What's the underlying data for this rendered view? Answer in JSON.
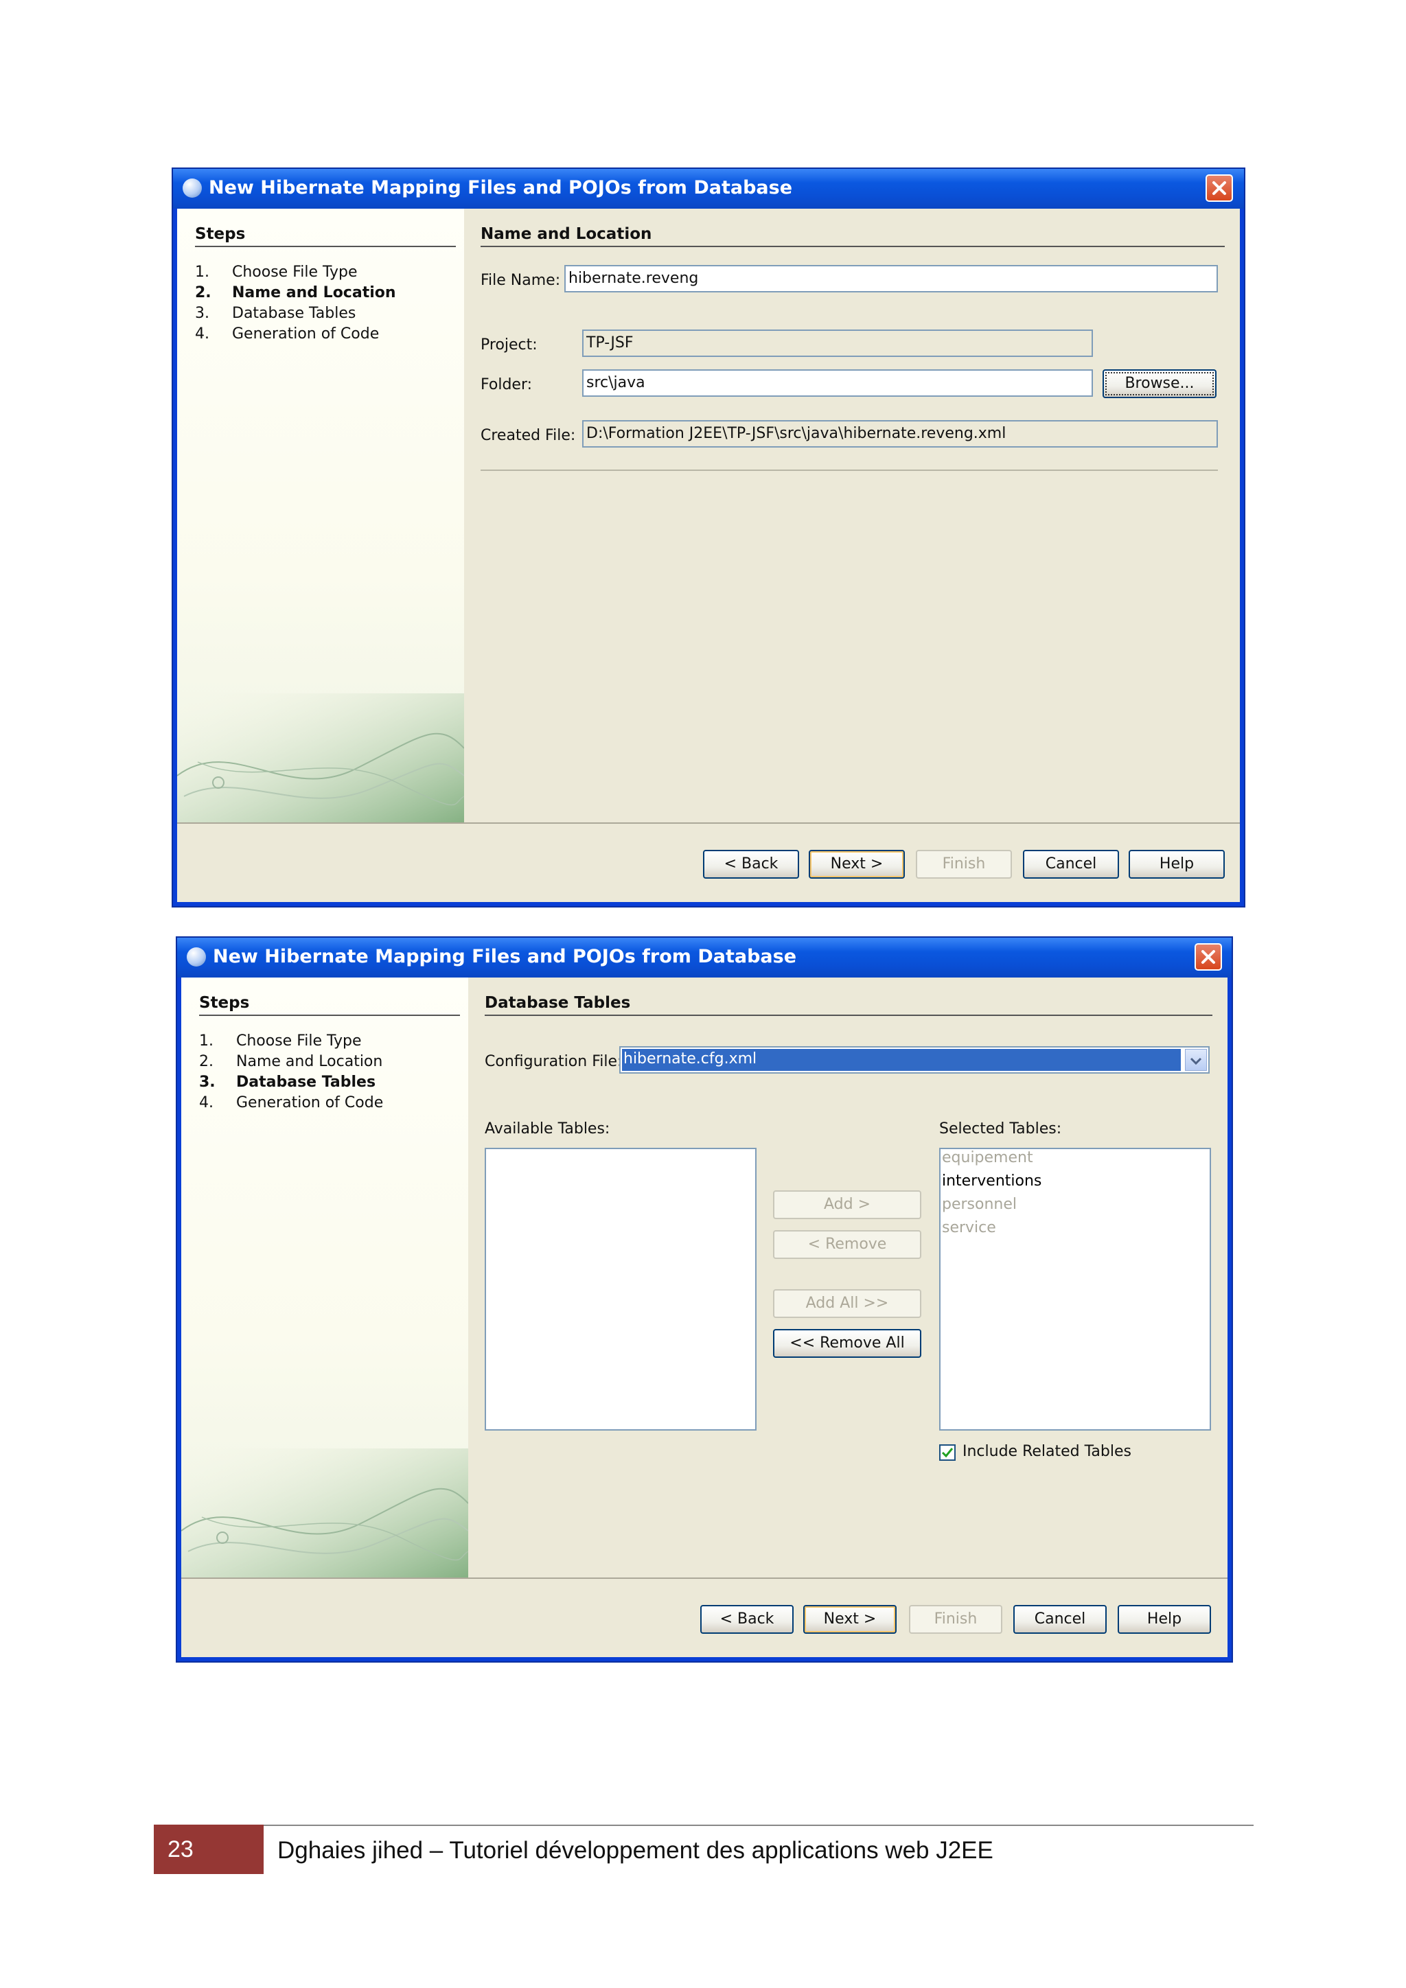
{
  "dialog1": {
    "title": "New Hibernate Mapping Files and POJOs from Database",
    "steps_heading": "Steps",
    "steps": [
      {
        "num": "1.",
        "label": "Choose File Type"
      },
      {
        "num": "2.",
        "label": "Name and Location"
      },
      {
        "num": "3.",
        "label": "Database Tables"
      },
      {
        "num": "4.",
        "label": "Generation of Code"
      }
    ],
    "current_step": 2,
    "panel_heading": "Name and Location",
    "file_name_label": "File Name:",
    "file_name_value": "hibernate.reveng",
    "project_label": "Project:",
    "project_value": "TP-JSF",
    "folder_label": "Folder:",
    "folder_value": "src\\java",
    "browse_label": "Browse...",
    "created_file_label": "Created File:",
    "created_file_value": "D:\\Formation J2EE\\TP-JSF\\src\\java\\hibernate.reveng.xml",
    "buttons": {
      "back": "< Back",
      "next": "Next >",
      "finish": "Finish",
      "cancel": "Cancel",
      "help": "Help"
    }
  },
  "dialog2": {
    "title": "New Hibernate Mapping Files and POJOs from Database",
    "steps_heading": "Steps",
    "steps": [
      {
        "num": "1.",
        "label": "Choose File Type"
      },
      {
        "num": "2.",
        "label": "Name and Location"
      },
      {
        "num": "3.",
        "label": "Database Tables"
      },
      {
        "num": "4.",
        "label": "Generation of Code"
      }
    ],
    "current_step": 3,
    "panel_heading": "Database Tables",
    "config_label": "Configuration File:",
    "config_value": "hibernate.cfg.xml",
    "available_label": "Available Tables:",
    "selected_label": "Selected Tables:",
    "selected_tables": [
      {
        "name": "equipement",
        "dimmed": true
      },
      {
        "name": "interventions",
        "dimmed": false
      },
      {
        "name": "personnel",
        "dimmed": true
      },
      {
        "name": "service",
        "dimmed": true
      }
    ],
    "add_label": "Add >",
    "remove_label": "< Remove",
    "add_all_label": "Add All >>",
    "remove_all_label": "<< Remove All",
    "include_related_label": "Include Related Tables",
    "include_related_checked": true,
    "buttons": {
      "back": "< Back",
      "next": "Next >",
      "finish": "Finish",
      "cancel": "Cancel",
      "help": "Help"
    }
  },
  "page_footer": {
    "page_number": "23",
    "text": "Dghaies jihed – Tutoriel développement des applications web  J2EE"
  },
  "colors": {
    "titlebar": "#0a4fd5",
    "dialog_bg": "#ece9d8",
    "page_number_bg": "#953734",
    "selection": "#316ac5"
  }
}
